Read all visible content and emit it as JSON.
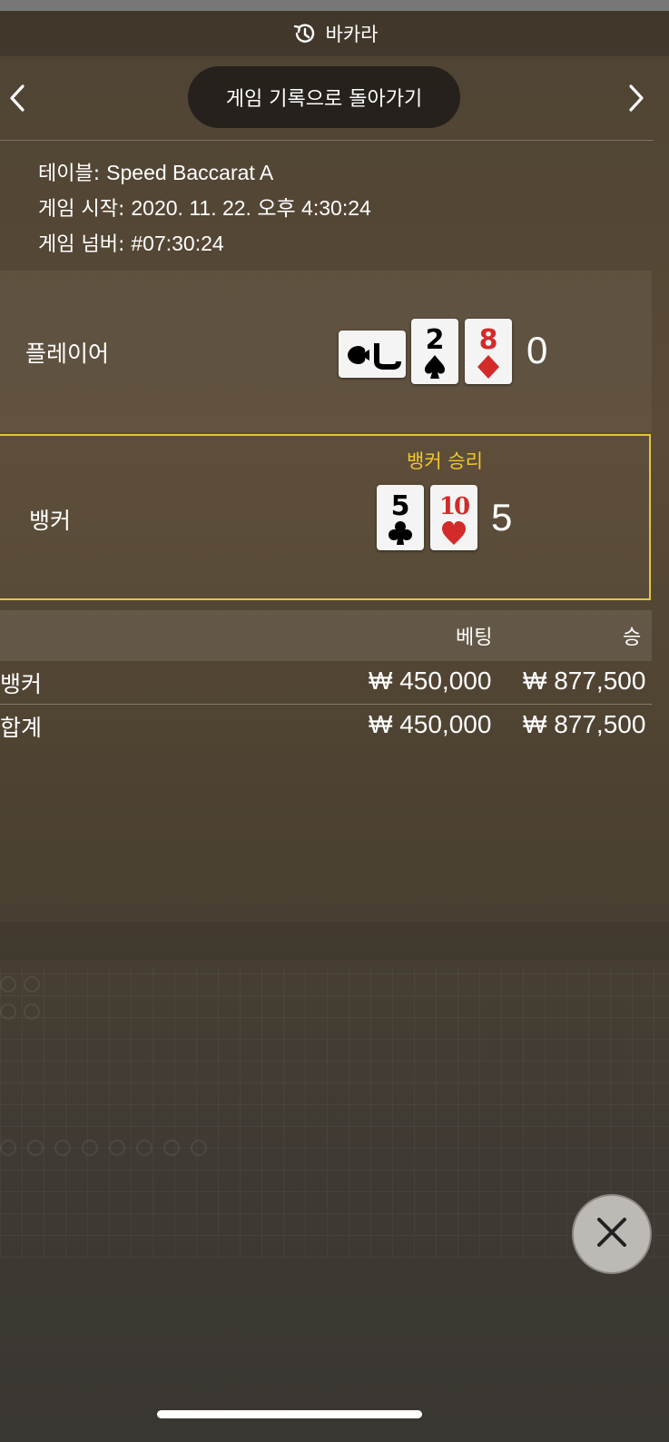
{
  "header": {
    "title": "바카라",
    "icon": "history-icon"
  },
  "nav": {
    "back_label": "게임 기록으로 돌아가기",
    "prev_icon": "chevron-left-icon",
    "next_icon": "chevron-right-icon"
  },
  "info": {
    "table_label": "테이블:",
    "table_value": "Speed Baccarat A",
    "start_label": "게임 시작:",
    "start_value": "2020. 11. 22. 오후 4:30:24",
    "number_label": "게임 넘버:",
    "number_value": "#07:30:24"
  },
  "player": {
    "label": "플레이어",
    "score": "0",
    "cards": [
      {
        "rank": "J",
        "suit": "spade",
        "color": "#000000",
        "rotated": true
      },
      {
        "rank": "2",
        "suit": "spade",
        "color": "#000000",
        "rotated": false
      },
      {
        "rank": "8",
        "suit": "diamond",
        "color": "#d32a2a",
        "rotated": false
      }
    ]
  },
  "banker": {
    "label": "뱅커",
    "score": "5",
    "result": "뱅커 승리",
    "cards": [
      {
        "rank": "5",
        "suit": "club",
        "color": "#000000",
        "rotated": false
      },
      {
        "rank": "10",
        "suit": "heart",
        "color": "#d32a2a",
        "rotated": false
      }
    ]
  },
  "bets": {
    "headers": {
      "bet": "베팅",
      "win": "승"
    },
    "rows": [
      {
        "name": "뱅커",
        "bet": "₩ 450,000",
        "win": "₩ 877,500"
      },
      {
        "name": "합계",
        "bet": "₩ 450,000",
        "win": "₩ 877,500"
      }
    ]
  },
  "close_icon": "close-icon",
  "colors": {
    "accent_yellow": "#e5c53a",
    "win_text": "#f2c62c",
    "red_suit": "#d32a2a"
  }
}
